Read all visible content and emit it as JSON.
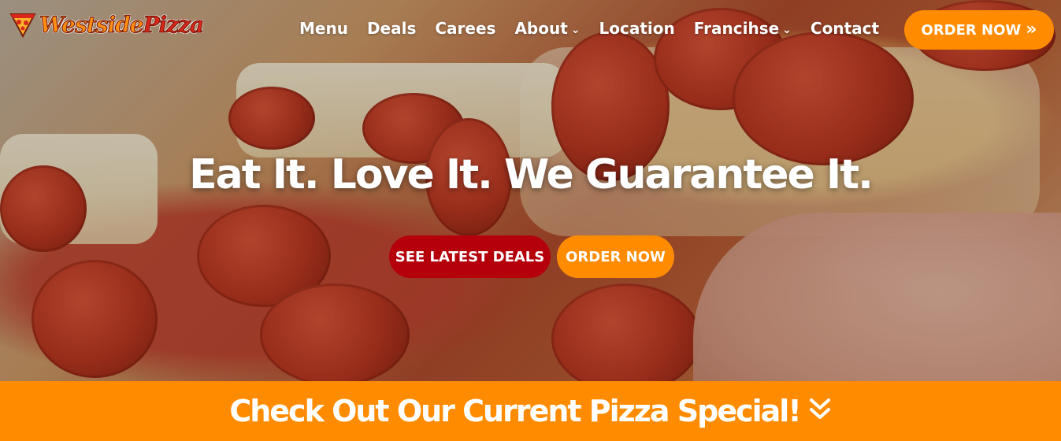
{
  "brand": {
    "name_part1": "Westside",
    "name_part2": "Pizza"
  },
  "nav": {
    "items": [
      {
        "label": "Menu",
        "dropdown": false
      },
      {
        "label": "Deals",
        "dropdown": false
      },
      {
        "label": "Carees",
        "dropdown": false
      },
      {
        "label": "About",
        "dropdown": true
      },
      {
        "label": "Location",
        "dropdown": false
      },
      {
        "label": "Francihse",
        "dropdown": true
      },
      {
        "label": "Contact",
        "dropdown": false
      }
    ],
    "order_button": "ORDER NOW"
  },
  "hero": {
    "headline": "Eat It. Love It. We Guarantee It.",
    "deals_button": "SEE LATEST DEALS",
    "order_button": "ORDER NOW"
  },
  "banner": {
    "text": "Check Out Our Current Pizza Special!"
  },
  "colors": {
    "orange": "#ff8c00",
    "red": "#b5000c"
  }
}
